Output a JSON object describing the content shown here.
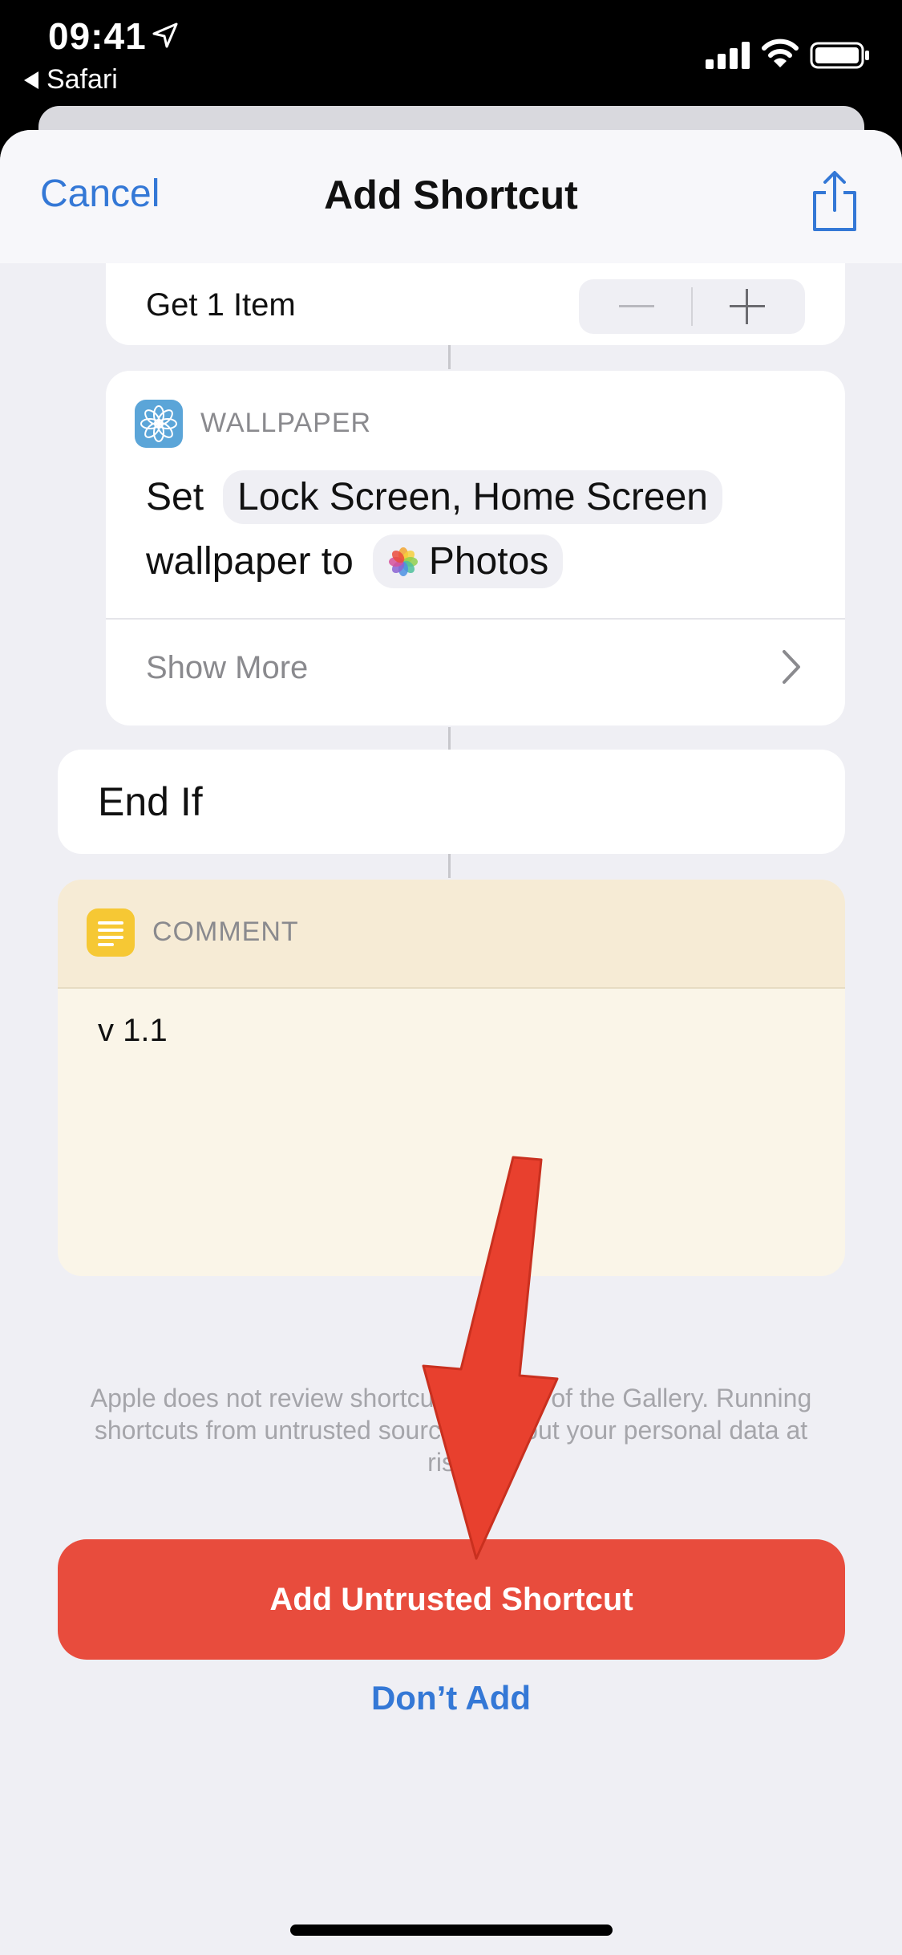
{
  "status_bar": {
    "time": "09:41",
    "back_app": "Safari"
  },
  "nav": {
    "cancel_label": "Cancel",
    "title": "Add Shortcut"
  },
  "get_item_action": {
    "label": "Get 1 Item"
  },
  "wallpaper_action": {
    "category": "WALLPAPER",
    "set_word": "Set",
    "location_token": "Lock Screen, Home Screen",
    "wallpaper_to": "wallpaper to",
    "photos_token": "Photos",
    "show_more": "Show More"
  },
  "end_if_action": {
    "label": "End If"
  },
  "comment_action": {
    "category": "COMMENT",
    "text": "v 1.1"
  },
  "warning_text": "Apple does not review shortcuts outside of the Gallery. Running shortcuts from untrusted sources can put your personal data at risk.",
  "buttons": {
    "add_untrusted": "Add Untrusted Shortcut",
    "dont_add": "Don’t Add"
  },
  "colors": {
    "accent_blue": "#3478d6",
    "destructive_red": "#e84c3d",
    "annotation_arrow": "#e8402e"
  }
}
